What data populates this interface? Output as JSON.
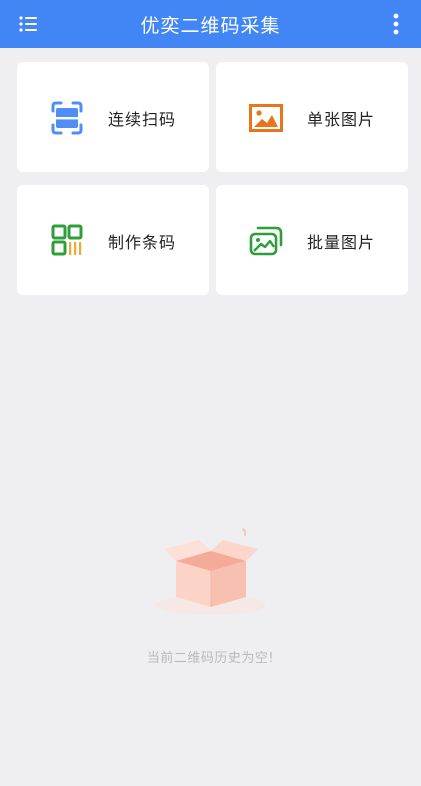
{
  "header": {
    "title": "优奕二维码采集"
  },
  "actions": [
    {
      "label": "连续扫码",
      "icon": "scan-frame-icon",
      "color": "#4f8ef7"
    },
    {
      "label": "单张图片",
      "icon": "image-icon",
      "color": "#e8741c"
    },
    {
      "label": "制作条码",
      "icon": "qrcode-icon",
      "color": "#2e9d3a"
    },
    {
      "label": "批量图片",
      "icon": "multi-image-icon",
      "color": "#2e9d3a"
    }
  ],
  "empty_state": {
    "message": "当前二维码历史为空!",
    "icon": "empty-box-icon"
  },
  "colors": {
    "header_bg": "#4285f4",
    "page_bg": "#efeff1",
    "card_bg": "#ffffff"
  }
}
